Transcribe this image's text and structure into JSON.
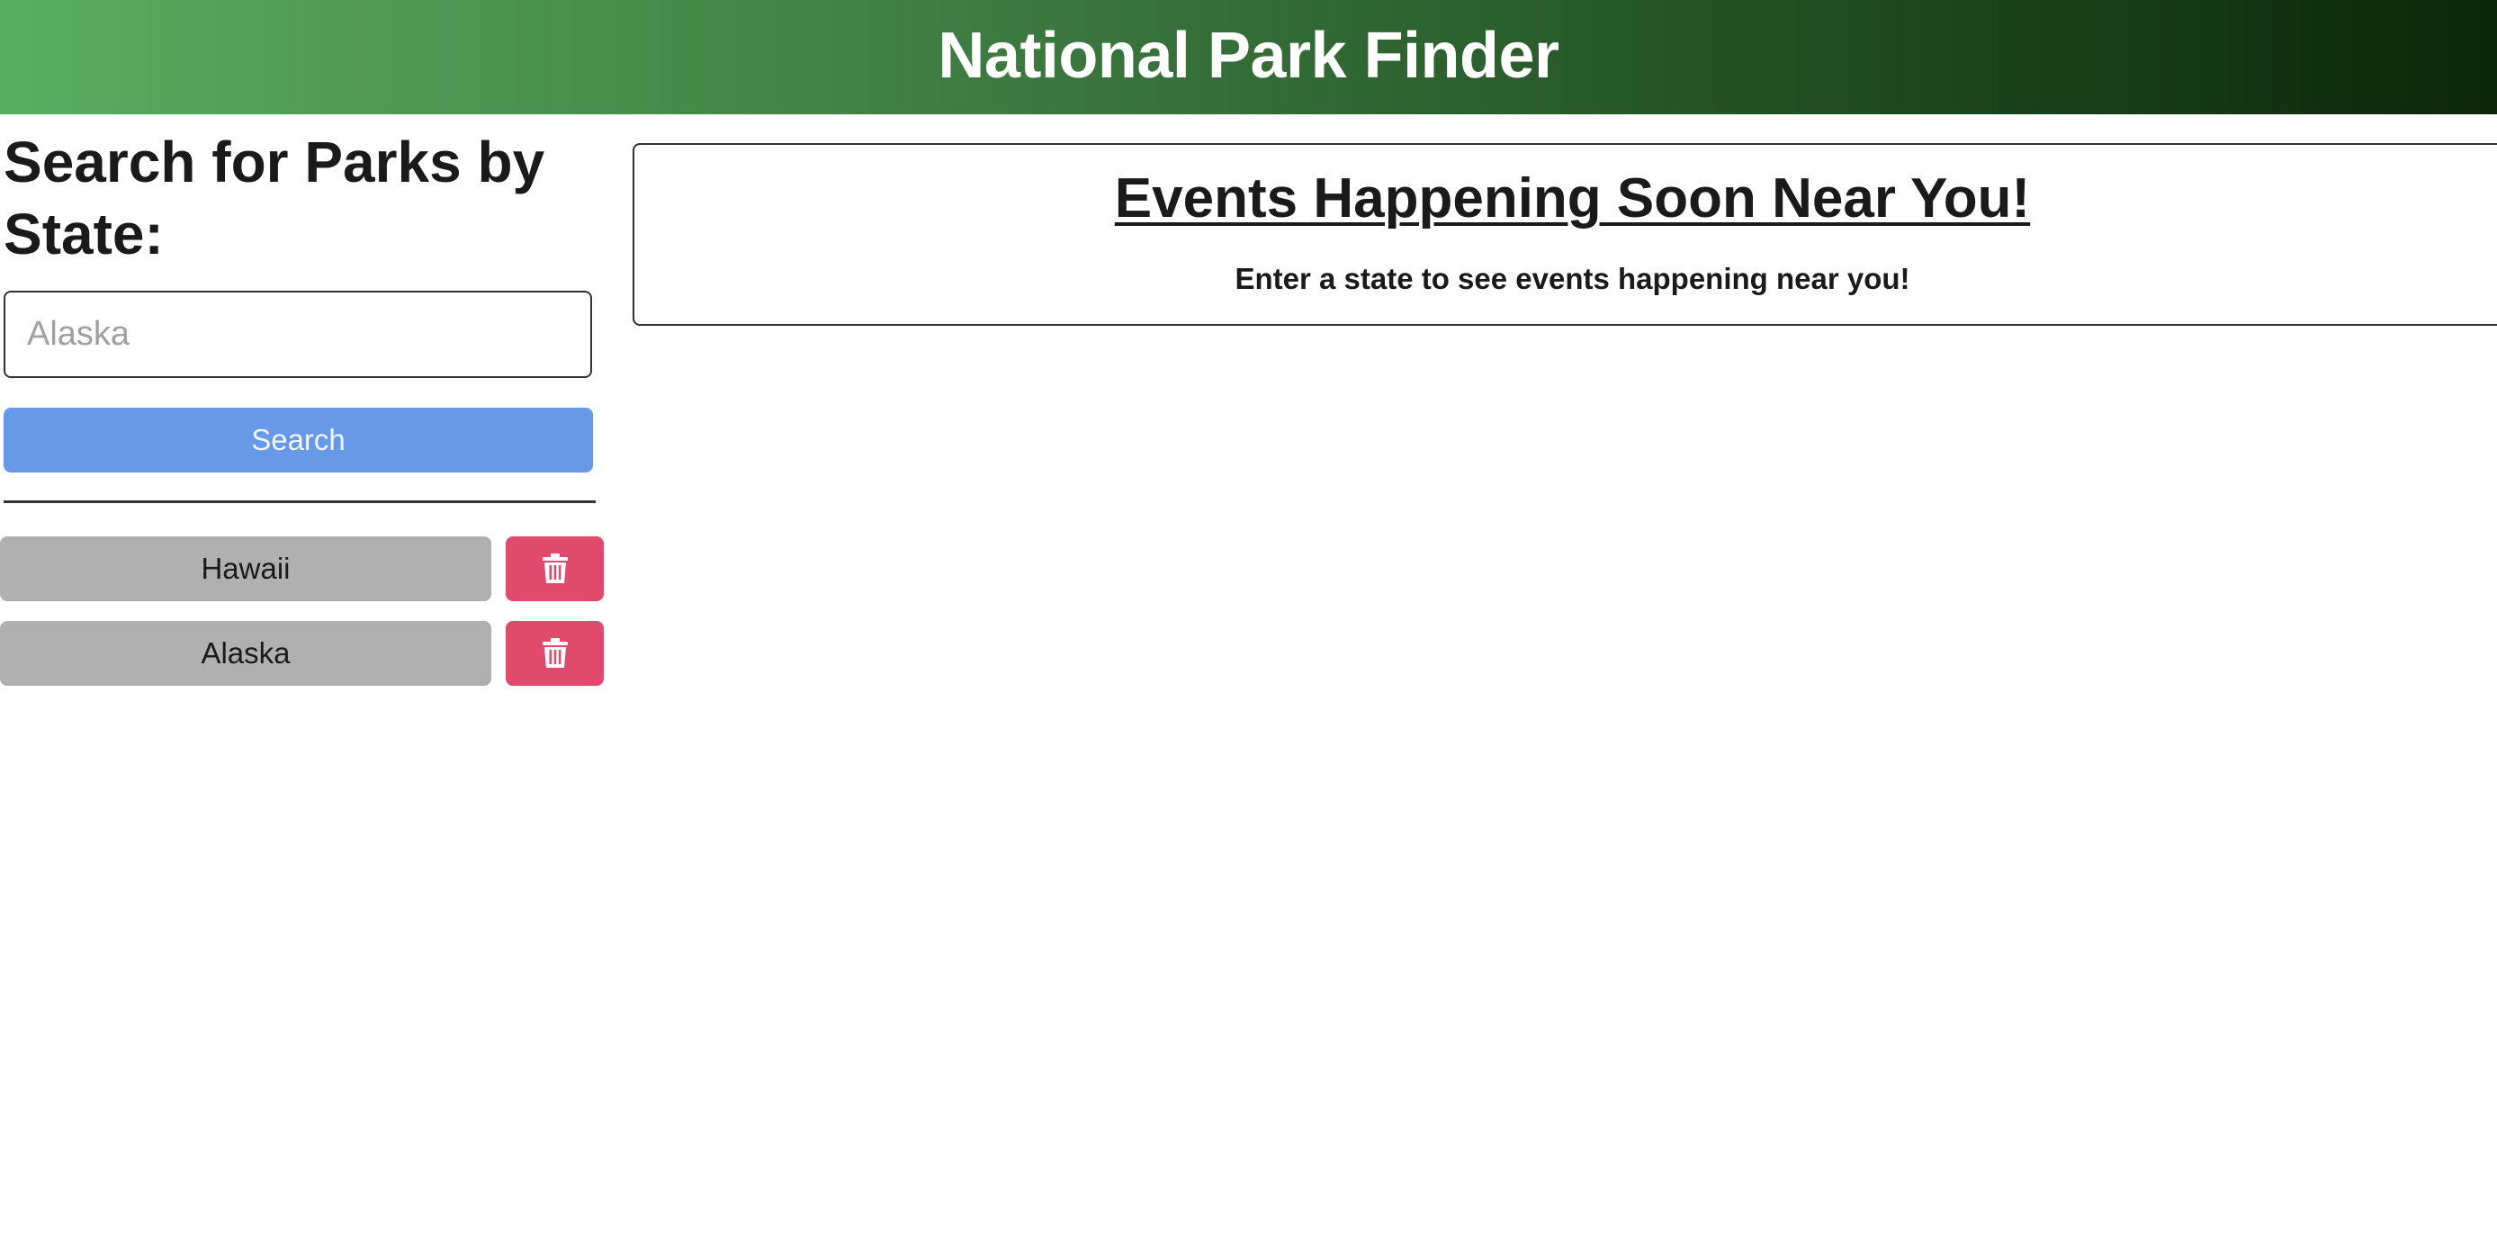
{
  "header": {
    "title": "National Park Finder"
  },
  "search": {
    "heading": "Search for Parks by State:",
    "placeholder": "Alaska",
    "value": "",
    "button_label": "Search"
  },
  "history": {
    "items": [
      {
        "label": "Hawaii"
      },
      {
        "label": "Alaska"
      }
    ],
    "delete_icon": "trash-icon"
  },
  "events": {
    "heading": "Events Happening Soon Near You!",
    "message": "Enter a state to see events happening near you!"
  },
  "colors": {
    "header_gradient_start": "#5aad62",
    "header_gradient_end": "#0c2609",
    "search_button": "#6699e8",
    "history_button": "#b0b0b0",
    "delete_button": "#e04a6c"
  }
}
